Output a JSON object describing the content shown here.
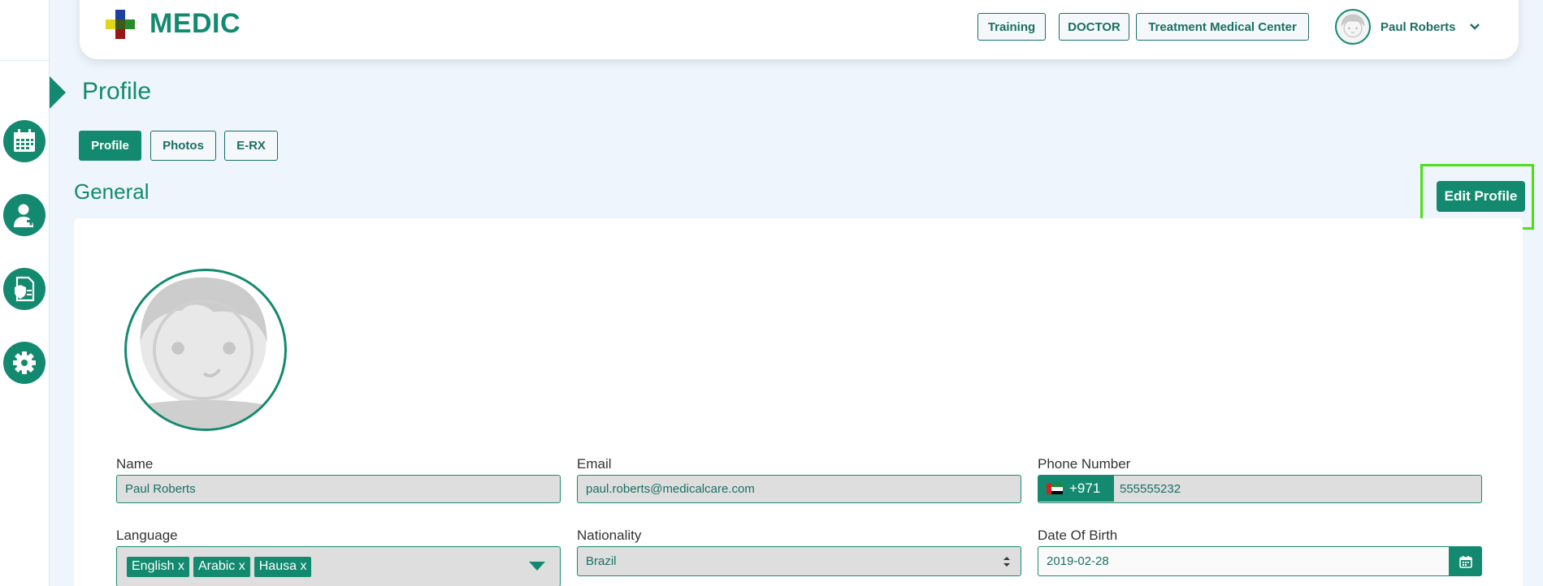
{
  "app": {
    "name": "MEDIC"
  },
  "header": {
    "buttons": [
      {
        "label": "Training"
      },
      {
        "label": "DOCTOR"
      },
      {
        "label": "Treatment Medical Center"
      }
    ],
    "user_name": "Paul Roberts"
  },
  "sidebar": {
    "items": [
      {
        "icon": "calendar-icon"
      },
      {
        "icon": "doctor-icon"
      },
      {
        "icon": "medical-document-icon"
      },
      {
        "icon": "gear-icon"
      }
    ]
  },
  "page": {
    "title": "Profile",
    "tabs": [
      {
        "label": "Profile",
        "active": true
      },
      {
        "label": "Photos",
        "active": false
      },
      {
        "label": "E-RX",
        "active": false
      }
    ],
    "section_title": "General",
    "edit_button": "Edit Profile"
  },
  "form": {
    "name_label": "Name",
    "name_value": "Paul Roberts",
    "email_label": "Email",
    "email_value": "paul.roberts@medicalcare.com",
    "phone_label": "Phone Number",
    "phone_code": "+971",
    "phone_value": "555555232",
    "language_label": "Language",
    "languages": [
      "English",
      "Arabic",
      "Hausa"
    ],
    "tag_remove": "x",
    "nationality_label": "Nationality",
    "nationality_value": "Brazil",
    "dob_label": "Date Of Birth",
    "dob_value": "2019-02-28"
  },
  "colors": {
    "primary": "#138a6f",
    "highlight": "#4ddf18",
    "background": "#eef5fd"
  }
}
